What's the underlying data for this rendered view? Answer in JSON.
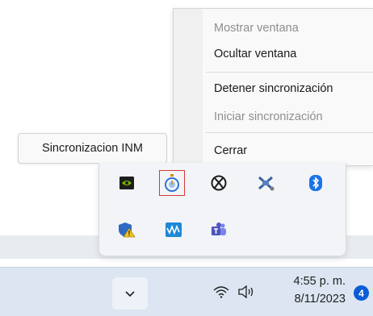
{
  "context_menu": {
    "items": [
      {
        "label": "Mostrar ventana",
        "enabled": false
      },
      {
        "label": "Ocultar ventana",
        "enabled": true
      },
      {
        "label": "Detener sincronización",
        "enabled": true
      },
      {
        "label": "Iniciar sincronización",
        "enabled": false
      },
      {
        "label": "Cerrar",
        "enabled": true
      }
    ]
  },
  "tooltip": {
    "text": "Sincronizacion INM"
  },
  "tray_flyout": {
    "icons": [
      "nvidia-icon",
      "stopwatch-sync-icon",
      "xbox-icon",
      "tool-icon",
      "bluetooth-icon",
      "security-warning-icon",
      "waves-icon",
      "teams-icon"
    ],
    "selected_icon": "stopwatch-sync-icon"
  },
  "taskbar": {
    "chevron_icon": "chevron-down-icon",
    "wifi_icon": "wifi-icon",
    "volume_icon": "volume-icon",
    "time": "4:55 p. m.",
    "date": "8/11/2023",
    "notification_count": "4"
  },
  "colors": {
    "accent": "#0b5cd7",
    "selection_outline": "#d43a3a",
    "taskbar": "#dce5f1"
  }
}
